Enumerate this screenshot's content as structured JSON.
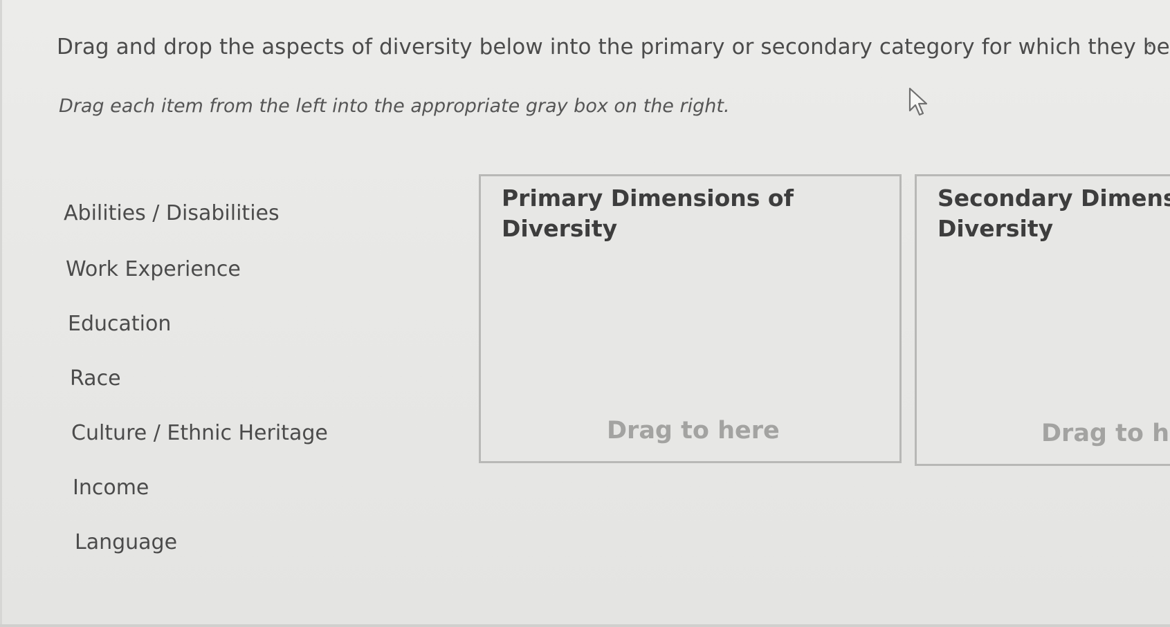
{
  "question": {
    "instruction": "Drag and drop the aspects of diversity below into the primary or secondary category for which they belong.",
    "sub_instruction": "Drag each item from the left into the appropriate gray box on the right."
  },
  "drag_items": [
    {
      "label": "Abilities / Disabilities"
    },
    {
      "label": "Work Experience"
    },
    {
      "label": "Education"
    },
    {
      "label": "Race"
    },
    {
      "label": "Culture / Ethnic Heritage"
    },
    {
      "label": "Income"
    },
    {
      "label": "Language"
    }
  ],
  "drop_zones": [
    {
      "title": "Primary Dimensions of Diversity",
      "hint": "Drag to here"
    },
    {
      "title": "Secondary Dimensi Diversity",
      "hint": "Drag to he"
    }
  ],
  "icons": {
    "cursor": "arrow-cursor-icon"
  }
}
